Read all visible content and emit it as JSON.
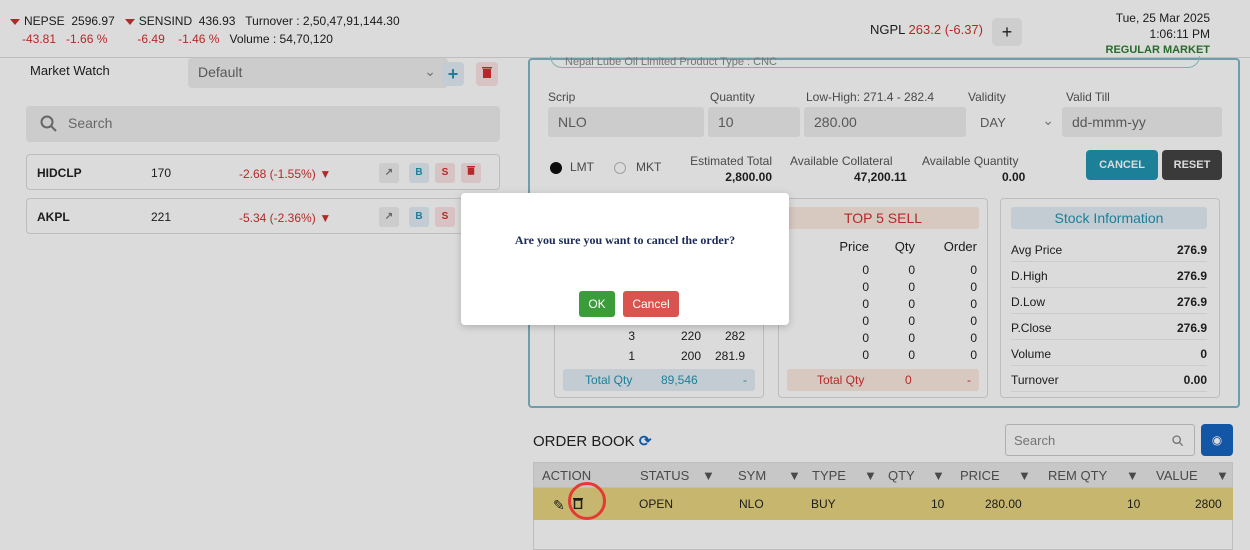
{
  "ticker": {
    "nepse_label": "NEPSE",
    "nepse_value": "2596.97",
    "nepse_change": "-43.81",
    "nepse_pct": "-1.66 %",
    "sensind_label": "SENSIND",
    "sensind_value": "436.93",
    "sensind_change": "-6.49",
    "sensind_pct": "-1.46 %",
    "turnover": "Turnover : 2,50,47,91,144.30",
    "volume": "Volume : 54,70,120",
    "ngpl_label": "NGPL",
    "ngpl_value": "263.2 (-6.37)",
    "plus": "+",
    "date": "Tue, 25 Mar 2025",
    "time": "1:06:11 PM",
    "market": "REGULAR MARKET"
  },
  "market_watch": {
    "label": "Market Watch",
    "selected": "Default",
    "search_placeholder": "Search",
    "rows": [
      {
        "sym": "HIDCLP",
        "price": "170",
        "change": "-2.68 (-1.55%)"
      },
      {
        "sym": "AKPL",
        "price": "221",
        "change": "-5.34 (-2.36%)"
      }
    ],
    "buy": "B",
    "sell": "S"
  },
  "order_form": {
    "header_partial": "Nepal Lube Oil Limited        Product Type : CNC",
    "scrip_label": "Scrip",
    "scrip": "NLO",
    "qty_label": "Quantity",
    "qty": "10",
    "lowhigh_label": "Low-High: 271.4 - 282.4",
    "price": "280.00",
    "validity_label": "Validity",
    "validity": "DAY",
    "validtill_label": "Valid Till",
    "validtill_placeholder": "dd-mmm-yy",
    "lmt": "LMT",
    "mkt": "MKT",
    "est_label": "Estimated Total",
    "est": "2,800.00",
    "coll_label": "Available Collateral",
    "coll": "47,200.11",
    "avq_label": "Available Quantity",
    "avq": "0.00",
    "cancel": "CANCEL",
    "reset": "RESET"
  },
  "depth": {
    "buy_rows": [
      {
        "order": "3",
        "qty": "220",
        "price": "282"
      },
      {
        "order": "1",
        "qty": "200",
        "price": "281.9"
      }
    ],
    "buy_total_label": "Total Qty",
    "buy_total": "89,546",
    "buy_dash": "-",
    "sell_title": "TOP 5 SELL",
    "sell_head": {
      "price": "Price",
      "qty": "Qty",
      "order": "Order"
    },
    "sell_rows": [
      {
        "price": "0",
        "qty": "0",
        "order": "0"
      },
      {
        "price": "0",
        "qty": "0",
        "order": "0"
      },
      {
        "price": "0",
        "qty": "0",
        "order": "0"
      },
      {
        "price": "0",
        "qty": "0",
        "order": "0"
      },
      {
        "price": "0",
        "qty": "0",
        "order": "0"
      },
      {
        "price": "0",
        "qty": "0",
        "order": "0"
      }
    ],
    "sell_total_label": "Total Qty",
    "sell_total": "0",
    "sell_dash": "-"
  },
  "stock_info": {
    "title": "Stock Information",
    "rows": [
      {
        "k": "Avg Price",
        "v": "276.9"
      },
      {
        "k": "D.High",
        "v": "276.9"
      },
      {
        "k": "D.Low",
        "v": "276.9"
      },
      {
        "k": "P.Close",
        "v": "276.9"
      },
      {
        "k": "Volume",
        "v": "0"
      },
      {
        "k": "Turnover",
        "v": "0.00"
      }
    ]
  },
  "order_book": {
    "title": "ORDER BOOK",
    "search_placeholder": "Search",
    "cols": [
      "ACTION",
      "STATUS",
      "SYM",
      "TYPE",
      "QTY",
      "PRICE",
      "REM QTY",
      "VALUE"
    ],
    "row": {
      "status": "OPEN",
      "sym": "NLO",
      "type": "BUY",
      "qty": "10",
      "price": "280.00",
      "rem": "10",
      "value": "2800"
    }
  },
  "modal": {
    "message": "Are you sure you want to cancel the order?",
    "ok": "OK",
    "cancel": "Cancel"
  },
  "colors": {
    "red": "#d32f2f",
    "green": "#2e7d32",
    "accent": "#1565c0",
    "teal": "#2196b3"
  }
}
